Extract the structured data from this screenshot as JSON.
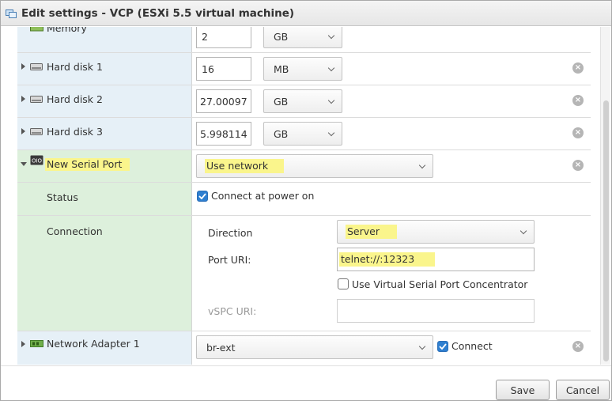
{
  "window": {
    "title": "Edit settings - VCP (ESXi 5.5 virtual machine)",
    "icon": "vm-settings-icon"
  },
  "devices": {
    "memory": {
      "label": "Memory",
      "value": "2",
      "unit": "GB"
    },
    "hard_disk_1": {
      "label": "Hard disk 1",
      "value": "16",
      "unit": "MB"
    },
    "hard_disk_2": {
      "label": "Hard disk 2",
      "value": "27.00097",
      "unit": "GB"
    },
    "hard_disk_3": {
      "label": "Hard disk 3",
      "value": "5.998114",
      "unit": "GB"
    },
    "serial_port": {
      "label": "New Serial Port",
      "type": "Use network",
      "status_label": "Status",
      "connect_power_on": "Connect at power on",
      "connect_power_on_checked": true,
      "connection_label": "Connection",
      "direction_label": "Direction",
      "direction_value": "Server",
      "port_uri_label": "Port URI:",
      "port_uri_value": "telnet://:12323",
      "vspc_checkbox": "Use Virtual Serial Port Concentrator",
      "vspc_checked": false,
      "vspc_uri_label": "vSPC URI:",
      "vspc_uri_value": ""
    },
    "network_adapter_1": {
      "label": "Network Adapter 1",
      "network": "br-ext",
      "connect_label": "Connect",
      "connect_checked": true
    }
  },
  "footer": {
    "save": "Save",
    "cancel": "Cancel"
  },
  "colors": {
    "highlight": "#faf58c",
    "device_panel": "#e6f0f7",
    "new_device_panel": "#ddf0dc",
    "checkbox": "#2f7fd0"
  }
}
